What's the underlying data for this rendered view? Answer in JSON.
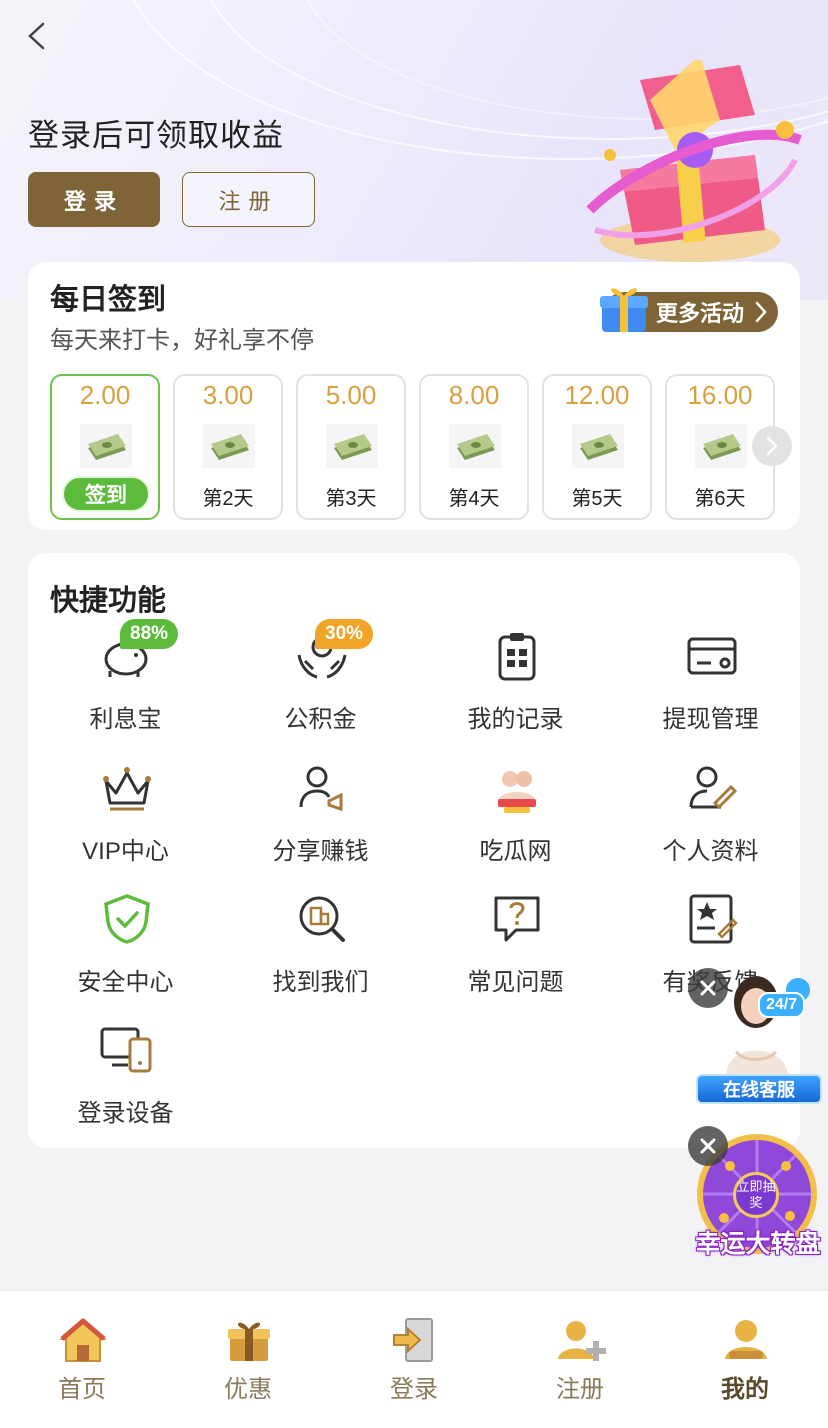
{
  "header": {
    "title": "登录后可领取收益",
    "login_label": "登录",
    "register_label": "注册"
  },
  "checkin": {
    "title": "每日签到",
    "subtitle": "每天来打卡，好礼享不停",
    "more_label": "更多活动",
    "days": [
      {
        "amount": "2.00",
        "label": "签到",
        "active": true
      },
      {
        "amount": "3.00",
        "label": "第2天",
        "active": false
      },
      {
        "amount": "5.00",
        "label": "第3天",
        "active": false
      },
      {
        "amount": "8.00",
        "label": "第4天",
        "active": false
      },
      {
        "amount": "12.00",
        "label": "第5天",
        "active": false
      },
      {
        "amount": "16.00",
        "label": "第6天",
        "active": false
      }
    ]
  },
  "quick": {
    "title": "快捷功能",
    "items": [
      {
        "label": "利息宝",
        "icon": "piggy-bank-icon",
        "badge": "88%"
      },
      {
        "label": "公积金",
        "icon": "hands-coin-icon",
        "badge": "30%"
      },
      {
        "label": "我的记录",
        "icon": "clipboard-icon"
      },
      {
        "label": "提现管理",
        "icon": "card-settings-icon"
      },
      {
        "label": "VIP中心",
        "icon": "crown-icon"
      },
      {
        "label": "分享赚钱",
        "icon": "user-megaphone-icon"
      },
      {
        "label": "吃瓜网",
        "icon": "promo-thumbnail-icon"
      },
      {
        "label": "个人资料",
        "icon": "user-edit-icon"
      },
      {
        "label": "安全中心",
        "icon": "shield-check-icon"
      },
      {
        "label": "找到我们",
        "icon": "search-building-icon"
      },
      {
        "label": "常见问题",
        "icon": "question-bubble-icon"
      },
      {
        "label": "有奖反馈",
        "icon": "star-form-icon"
      },
      {
        "label": "登录设备",
        "icon": "devices-icon"
      }
    ]
  },
  "floating": {
    "service_label": "在线客服",
    "service_tag": "24/7",
    "wheel_label": "幸运大转盘",
    "wheel_center": "立即抽奖"
  },
  "tabbar": {
    "tabs": [
      {
        "label": "首页",
        "icon": "home-icon"
      },
      {
        "label": "优惠",
        "icon": "gift-icon"
      },
      {
        "label": "登录",
        "icon": "login-door-icon"
      },
      {
        "label": "注册",
        "icon": "user-add-icon"
      },
      {
        "label": "我的",
        "icon": "user-icon",
        "active": true
      }
    ]
  },
  "colors": {
    "brand": "#7e6437",
    "gold_amount": "#d9a040",
    "green": "#5dbb3c",
    "orange": "#f0a526"
  }
}
